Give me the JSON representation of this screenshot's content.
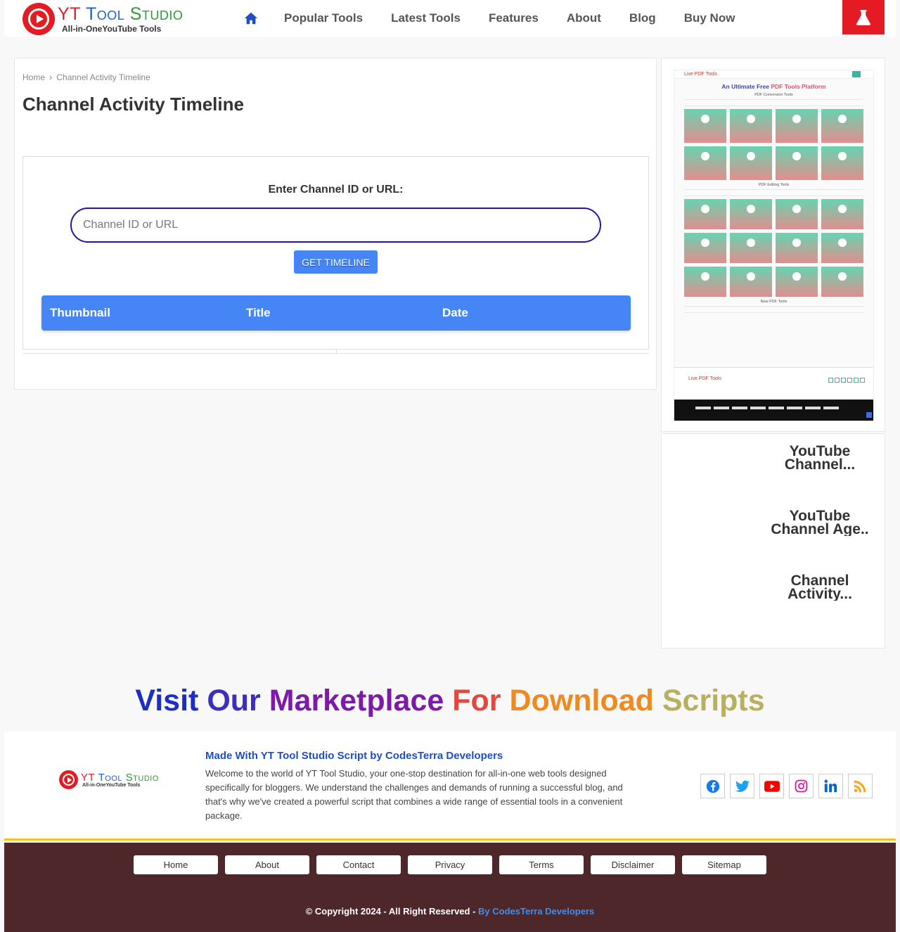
{
  "header": {
    "logo": {
      "yt": "YT",
      "tool": "Tool",
      "studio": "Studio",
      "tagline": "All-in-OneYouTube Tools"
    },
    "nav": [
      "Popular Tools",
      "Latest Tools",
      "Features",
      "About",
      "Blog",
      "Buy Now"
    ],
    "colors": {
      "brand_red": "#e51b23",
      "nav_home": "#1d4fc4"
    }
  },
  "breadcrumb": {
    "home": "Home",
    "current": "Channel Activity Timeline"
  },
  "page": {
    "title": "Channel Activity Timeline"
  },
  "tool": {
    "label": "Enter Channel ID or URL:",
    "input_value": "",
    "input_placeholder": "Channel ID or URL",
    "button": "GET TIMELINE",
    "table_headers": [
      "Thumbnail",
      "Title",
      "Date"
    ],
    "accent": "#4585f5"
  },
  "sidebar": {
    "preview": {
      "brand": "Live PDF Tools",
      "title_start": "An Ultimate Free",
      "title_highlight": "PDF Tools",
      "title_end": "Platform",
      "section1": "PDF Conversion Tools",
      "section2": "PDF Editing Tools",
      "section3": "New PDF Tools"
    },
    "tools": [
      {
        "line1": "YouTube",
        "line2": "Channel..."
      },
      {
        "line1": "YouTube",
        "line2": "Channel Age.."
      },
      {
        "line1": "Channel",
        "line2": "Activity..."
      }
    ]
  },
  "marketplace": [
    "Visit",
    "Our",
    "Marketplace",
    "For",
    "Download",
    "Scripts"
  ],
  "footer": {
    "logo": {
      "yt": "YT",
      "tool": "Tool",
      "studio": "Studio",
      "tagline": "All-in-OneYouTube Tools"
    },
    "made_title": "Made With YT Tool Studio Script by CodesTerra Developers",
    "made_text": "Welcome to the world of YT Tool Studio, your one-stop destination for all-in-one web tools designed specifically for bloggers. We understand the challenges and demands of running a successful blog, and that's why we've created a powerful script that combines a wide range of essential tools in a convenient package.",
    "socials": [
      "facebook-icon",
      "twitter-icon",
      "youtube-icon",
      "instagram-icon",
      "linkedin-icon",
      "rss-icon"
    ],
    "links": [
      "Home",
      "About",
      "Contact",
      "Privacy",
      "Terms",
      "Disclaimer",
      "Sitemap"
    ],
    "copyright": "© Copyright 2024 - All Right Reserved -",
    "copyright_by": "By CodesTerra Developers"
  }
}
